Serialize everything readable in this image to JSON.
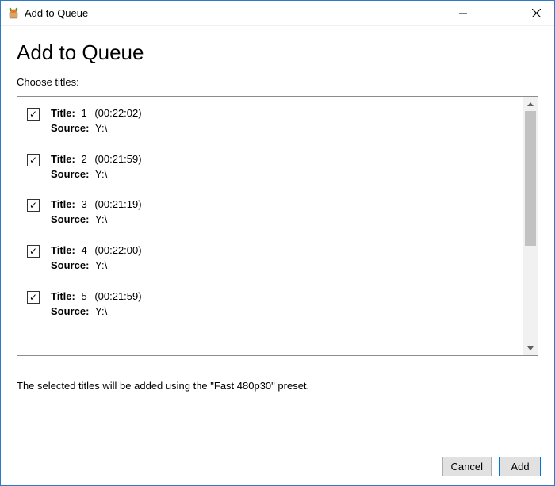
{
  "window": {
    "title": "Add to Queue"
  },
  "heading": "Add to Queue",
  "subheading": "Choose titles:",
  "labels": {
    "title": "Title:",
    "source": "Source:"
  },
  "items": [
    {
      "checked": true,
      "number": "1",
      "duration": "(00:22:02)",
      "source": "Y:\\"
    },
    {
      "checked": true,
      "number": "2",
      "duration": "(00:21:59)",
      "source": "Y:\\"
    },
    {
      "checked": true,
      "number": "3",
      "duration": "(00:21:19)",
      "source": "Y:\\"
    },
    {
      "checked": true,
      "number": "4",
      "duration": "(00:22:00)",
      "source": "Y:\\"
    },
    {
      "checked": true,
      "number": "5",
      "duration": "(00:21:59)",
      "source": "Y:\\"
    }
  ],
  "footer": {
    "prefix": "The selected titles will be added using the ",
    "preset": "\"Fast 480p30\"",
    "suffix": " preset."
  },
  "buttons": {
    "cancel": "Cancel",
    "add": "Add"
  }
}
